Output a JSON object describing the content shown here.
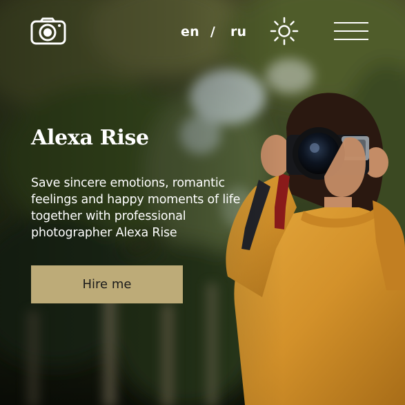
{
  "header": {
    "logo_icon": "camera-icon",
    "languages": [
      "en",
      "ru"
    ],
    "language_separator": "/",
    "theme_toggle_icon": "sun-icon",
    "menu_icon": "hamburger-menu-icon"
  },
  "hero": {
    "title": "Alexa Rise",
    "description": "Save sincere emotions, romantic feelings and happy moments of life together with professional photographer Alexa Rise",
    "cta_label": "Hire me",
    "background_image": "photographer-with-camera-photo"
  },
  "colors": {
    "accent": "#bdab78",
    "text": "#ffffff",
    "button_text": "#1a1a1a"
  }
}
